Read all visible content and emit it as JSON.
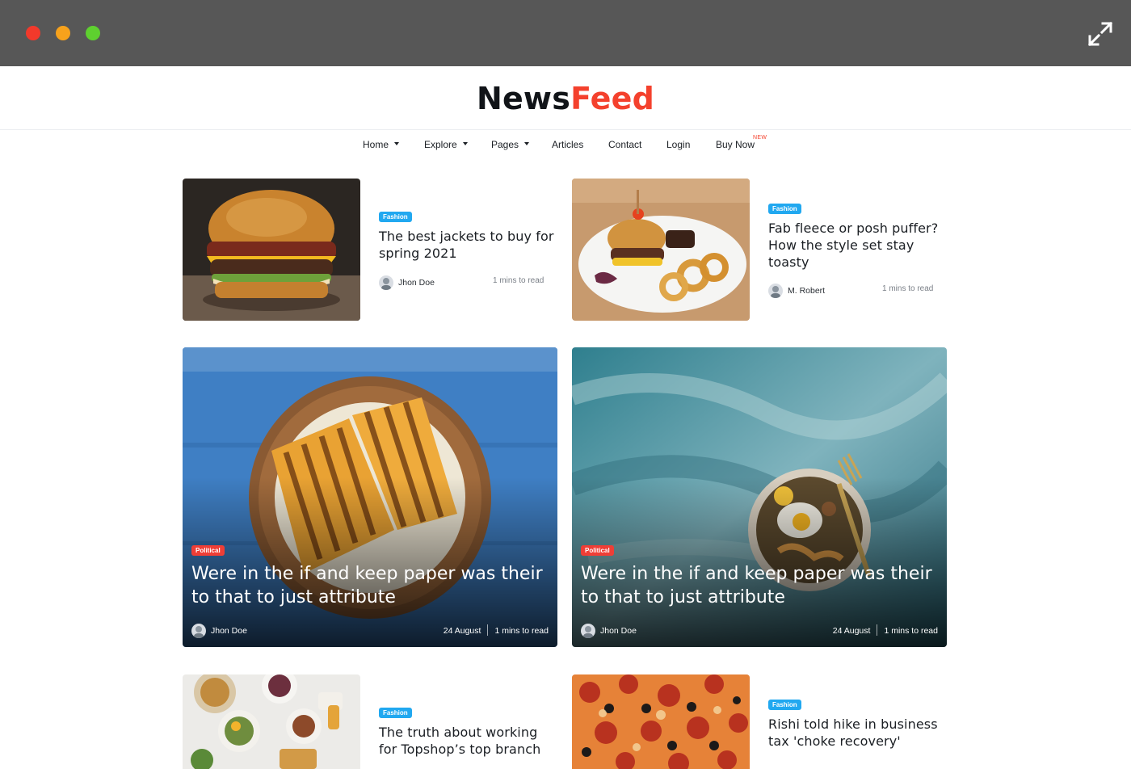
{
  "brand": {
    "part1": "News",
    "part2": "Feed",
    "accent": "#f4412d"
  },
  "nav": {
    "items": [
      {
        "label": "Home",
        "dropdown": true
      },
      {
        "label": "Explore",
        "dropdown": true
      },
      {
        "label": "Pages",
        "dropdown": true
      },
      {
        "label": "Articles",
        "dropdown": false
      },
      {
        "label": "Contact",
        "dropdown": false
      },
      {
        "label": "Login",
        "dropdown": false
      },
      {
        "label": "Buy Now",
        "dropdown": false,
        "badge": "NEW"
      }
    ]
  },
  "small_cards": [
    {
      "tag": "Fashion",
      "title": "The best jackets to buy for spring 2021",
      "author": "Jhon Doe",
      "readtime": "1 mins to read",
      "image": "burger"
    },
    {
      "tag": "Fashion",
      "title": "Fab fleece or posh puffer? How the style set stay toasty",
      "author": "M. Robert",
      "readtime": "1 mins to read",
      "image": "burger-plate"
    },
    {
      "tag": "Fashion",
      "title": "The truth about working for Topshop’s top branch",
      "image": "breakfast-table"
    },
    {
      "tag": "Fashion",
      "title": "Rishi told hike in business tax 'choke recovery'",
      "image": "pizza"
    }
  ],
  "big_cards": [
    {
      "tag": "Political",
      "title": "Were in the if and keep paper was their to that to just attribute",
      "author": "Jhon Doe",
      "date": "24 August",
      "readtime": "1 mins to read",
      "image": "sandwich"
    },
    {
      "tag": "Political",
      "title": "Were in the if and keep paper was their to that to just attribute",
      "author": "Jhon Doe",
      "date": "24 August",
      "readtime": "1 mins to read",
      "image": "noodle-bowl"
    }
  ],
  "colors": {
    "fashion_tag": "#21a8f0",
    "political_tag": "#ef3e36",
    "chrome": "#575757"
  }
}
